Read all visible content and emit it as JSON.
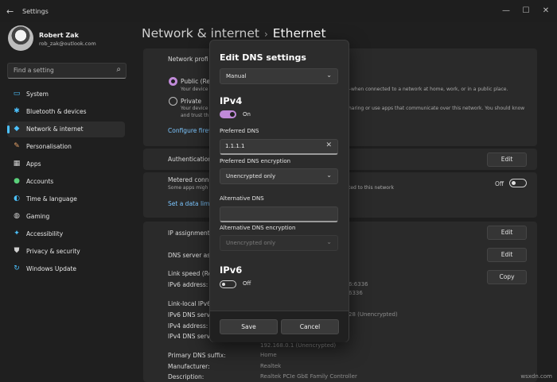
{
  "window": {
    "title": "Settings",
    "back_glyph": "←",
    "controls": [
      "—",
      "☐",
      "✕"
    ]
  },
  "user": {
    "name": "Robert Zak",
    "email": "rob_zak@outlook.com"
  },
  "search": {
    "placeholder": "Find a setting",
    "icon": "⌕"
  },
  "nav": [
    {
      "label": "System",
      "icon": "▭",
      "color": "#4cc2ff"
    },
    {
      "label": "Bluetooth & devices",
      "icon": "✱",
      "color": "#4cc2ff"
    },
    {
      "label": "Network & internet",
      "icon": "◆",
      "color": "#4cc2ff",
      "active": true
    },
    {
      "label": "Personalisation",
      "icon": "✎",
      "color": "#e8a36a"
    },
    {
      "label": "Apps",
      "icon": "▦",
      "color": "#d0d0d0"
    },
    {
      "label": "Accounts",
      "icon": "●",
      "color": "#5ad07a"
    },
    {
      "label": "Time & language",
      "icon": "◐",
      "color": "#4cc2ff"
    },
    {
      "label": "Gaming",
      "icon": "◍",
      "color": "#d0d0d0"
    },
    {
      "label": "Accessibility",
      "icon": "✦",
      "color": "#4cc2ff"
    },
    {
      "label": "Privacy & security",
      "icon": "⛊",
      "color": "#d0d0d0"
    },
    {
      "label": "Windows Update",
      "icon": "↻",
      "color": "#4cc2ff"
    }
  ],
  "breadcrumb": {
    "parent": "Network & internet",
    "separator": "›",
    "current": "Ethernet"
  },
  "main": {
    "network_profile": "Network profi",
    "public_label": "Public (Re",
    "public_desc_left": "Your device",
    "public_desc_right": "–when connected to a network at home, work, or in a public place.",
    "private_label": "Private",
    "private_desc_left": "Your device",
    "private_desc_left2": "and trust th",
    "private_desc_right": "haring or use apps that communicate over this network. You should know",
    "configure_link": "Configure firew",
    "authentication": "Authentication",
    "edit": "Edit",
    "metered_label": "Metered conne",
    "metered_sub_left": "Some apps migh",
    "metered_sub_right": "ted to this network",
    "metered_state": "Off",
    "data_limit_link": "Set a data limi",
    "ip_assignment": "IP assignment:",
    "dns_assignment": "DNS server assi",
    "link_speed": "Link speed (Rec",
    "ipv6_address": "IPv6 address:",
    "ipv6_value_1": "6:6336",
    "ipv6_value_2": "6336",
    "link_local": "Link-local IPv6",
    "ipv6_dns": "IPv6 DNS serve",
    "ipv6_dns_value": "28 (Unencrypted)",
    "ipv4_address": "IPv4 address:",
    "ipv4_dns": "IPv4 DNS serve",
    "ipv4_dns_value": "192.168.0.1 (Unencrypted)",
    "primary_dns_suffix": "Primary DNS suffix:",
    "primary_dns_suffix_value": "Home",
    "manufacturer": "Manufacturer:",
    "manufacturer_value": "Realtek",
    "description": "Description:",
    "description_value": "Realtek PCIe GbE Family Controller",
    "copy": "Copy"
  },
  "dialog": {
    "title": "Edit DNS settings",
    "mode": "Manual",
    "ipv4_heading": "IPv4",
    "ipv4_toggle": "On",
    "preferred_dns_label": "Preferred DNS",
    "preferred_dns_value": "1.1.1.1",
    "clear_glyph": "✕",
    "preferred_enc_label": "Preferred DNS encryption",
    "preferred_enc_value": "Unencrypted only",
    "alternative_dns_label": "Alternative DNS",
    "alternative_dns_value": "",
    "alternative_enc_label": "Alternative DNS encryption",
    "alternative_enc_value": "Unencrypted only",
    "ipv6_heading": "IPv6",
    "ipv6_toggle": "Off",
    "chevron": "⌄",
    "save": "Save",
    "cancel": "Cancel"
  },
  "watermark": "wsxdn.com",
  "colors": {
    "accent": "#c08ad8",
    "link": "#7cc6ff",
    "nav_accent": "#4cc2ff"
  }
}
